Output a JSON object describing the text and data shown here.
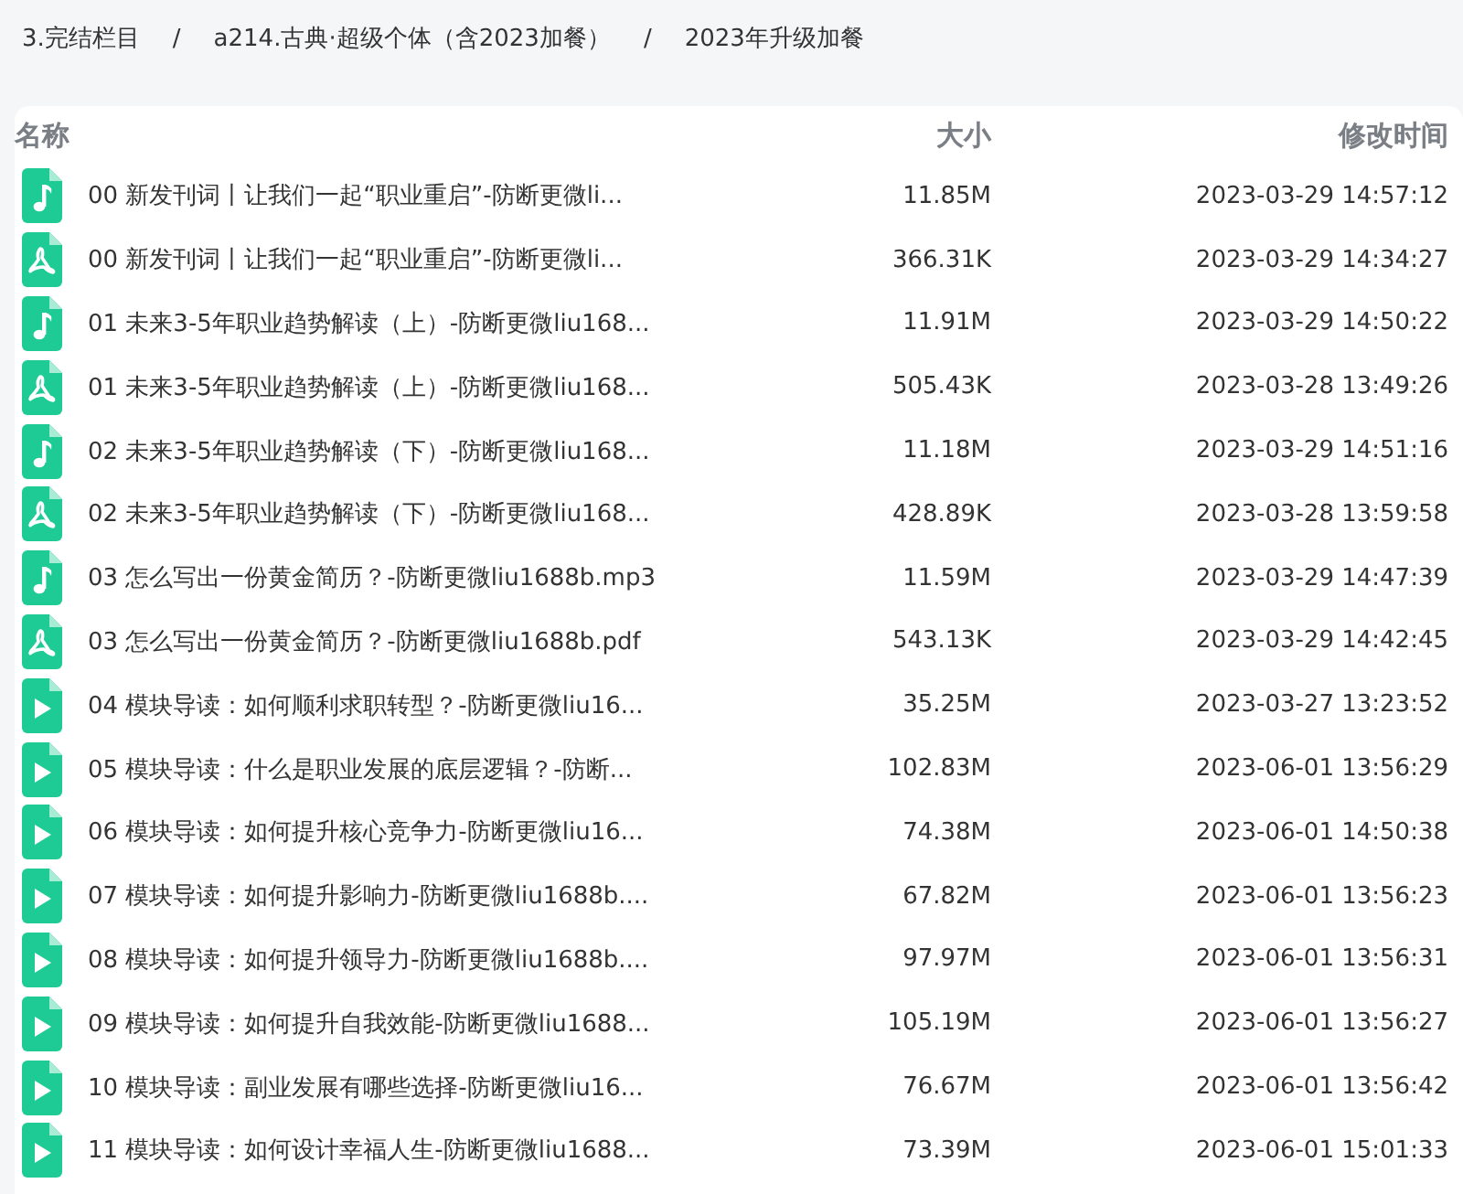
{
  "breadcrumb": [
    "3.完结栏目",
    "a214.古典·超级个体（含2023加餐）",
    "2023年升级加餐"
  ],
  "breadcrumb_separator": "/",
  "table": {
    "columns": [
      "名称",
      "大小",
      "修改时间"
    ],
    "rows": [
      {
        "kind": "audio",
        "name": "00 新发刊词丨让我们一起“职业重启”-防断更微li...",
        "size": "11.85M",
        "modified": "2023-03-29 14:57:12"
      },
      {
        "kind": "pdf",
        "name": "00 新发刊词丨让我们一起“职业重启”-防断更微li...",
        "size": "366.31K",
        "modified": "2023-03-29 14:34:27"
      },
      {
        "kind": "audio",
        "name": "01 未来3-5年职业趋势解读（上）-防断更微liu168...",
        "size": "11.91M",
        "modified": "2023-03-29 14:50:22"
      },
      {
        "kind": "pdf",
        "name": "01 未来3-5年职业趋势解读（上）-防断更微liu168...",
        "size": "505.43K",
        "modified": "2023-03-28 13:49:26"
      },
      {
        "kind": "audio",
        "name": "02 未来3-5年职业趋势解读（下）-防断更微liu168...",
        "size": "11.18M",
        "modified": "2023-03-29 14:51:16"
      },
      {
        "kind": "pdf",
        "name": "02 未来3-5年职业趋势解读（下）-防断更微liu168...",
        "size": "428.89K",
        "modified": "2023-03-28 13:59:58"
      },
      {
        "kind": "audio",
        "name": "03 怎么写出一份黄金简历？-防断更微liu1688b.mp3",
        "size": "11.59M",
        "modified": "2023-03-29 14:47:39"
      },
      {
        "kind": "pdf",
        "name": "03 怎么写出一份黄金简历？-防断更微liu1688b.pdf",
        "size": "543.13K",
        "modified": "2023-03-29 14:42:45"
      },
      {
        "kind": "video",
        "name": "04 模块导读：如何顺利求职转型？-防断更微liu16...",
        "size": "35.25M",
        "modified": "2023-03-27 13:23:52"
      },
      {
        "kind": "video",
        "name": "05 模块导读：什么是职业发展的底层逻辑？-防断...",
        "size": "102.83M",
        "modified": "2023-06-01 13:56:29"
      },
      {
        "kind": "video",
        "name": "06 模块导读：如何提升核心竞争力-防断更微liu16...",
        "size": "74.38M",
        "modified": "2023-06-01 14:50:38"
      },
      {
        "kind": "video",
        "name": "07 模块导读：如何提升影响力-防断更微liu1688b....",
        "size": "67.82M",
        "modified": "2023-06-01 13:56:23"
      },
      {
        "kind": "video",
        "name": "08 模块导读：如何提升领导力-防断更微liu1688b....",
        "size": "97.97M",
        "modified": "2023-06-01 13:56:31"
      },
      {
        "kind": "video",
        "name": "09 模块导读：如何提升自我效能-防断更微liu1688...",
        "size": "105.19M",
        "modified": "2023-06-01 13:56:27"
      },
      {
        "kind": "video",
        "name": "10 模块导读：副业发展有哪些选择-防断更微liu16...",
        "size": "76.67M",
        "modified": "2023-06-01 13:56:42"
      },
      {
        "kind": "video",
        "name": "11 模块导读：如何设计幸福人生-防断更微liu1688...",
        "size": "73.39M",
        "modified": "2023-06-01 15:01:33"
      }
    ]
  }
}
